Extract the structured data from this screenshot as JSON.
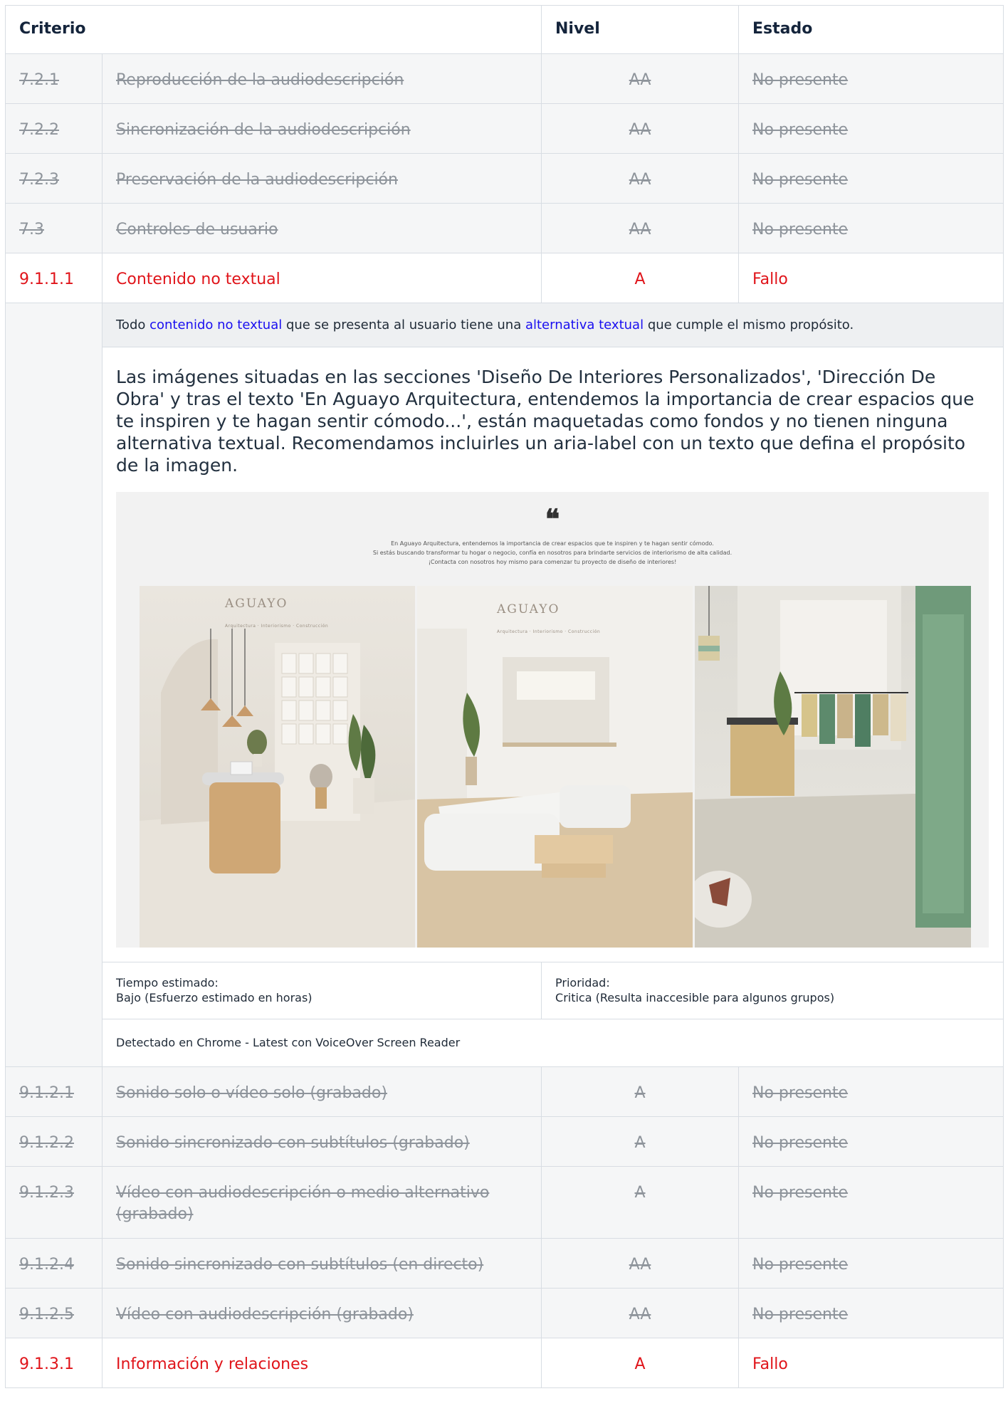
{
  "header": {
    "criterio": "Criterio",
    "nivel": "Nivel",
    "estado": "Estado"
  },
  "rows_top": [
    {
      "num": "7.2.1",
      "name": "Reproducción de la audiodescripción",
      "level": "AA",
      "status": "No presente"
    },
    {
      "num": "7.2.2",
      "name": "Sincronización de la audiodescripción",
      "level": "AA",
      "status": "No presente"
    },
    {
      "num": "7.2.3",
      "name": "Preservación de la audiodescripción",
      "level": "AA",
      "status": "No presente"
    },
    {
      "num": "7.3",
      "name": "Controles de usuario",
      "level": "AA",
      "status": "No presente"
    }
  ],
  "failure": {
    "num": "9.1.1.1",
    "name": "Contenido no textual",
    "level": "A",
    "status": "Fallo",
    "summary_start": "Todo ",
    "summary_link1": "contenido no textual",
    "summary_mid": " que se presenta al usuario tiene una ",
    "summary_link2": "alternativa textual",
    "summary_end": " que cumple el mismo propósito.",
    "description": "Las imágenes situadas en las secciones 'Diseño De Interiores Personalizados', 'Dirección De Obra' y tras el texto 'En Aguayo Arquitectura, entendemos la importancia de crear espacios que te inspiren y te hagan sentir cómodo...', están maquetadas como fondos y no tienen ninguna alternativa textual. Recomendamos incluirles un aria-label con un texto que defina el propósito de la imagen.",
    "screenshot": {
      "quote_mark": "❝",
      "line1": "En Aguayo Arquitectura, entendemos la importancia de crear espacios que te inspiren y te hagan sentir cómodo.",
      "line2": "Si estás buscando transformar tu hogar o negocio, confía en nosotros para brindarte servicios de interiorismo de alta calidad.",
      "line3": "¡Contacta con nosotros hoy mismo para comenzar tu proyecto de diseño de interiores!",
      "brand": "AGUAYO",
      "brand_sub": "Arquitectura · Interiorismo · Construcción"
    },
    "time_label": "Tiempo estimado:",
    "time_value": "Bajo (Esfuerzo estimado en horas)",
    "priority_label": "Prioridad:",
    "priority_value": "Critica (Resulta inaccesible para algunos grupos)",
    "detected": "Detectado en Chrome - Latest con VoiceOver Screen Reader"
  },
  "rows_bottom": [
    {
      "num": "9.1.2.1",
      "name": "Sonido solo o vídeo solo (grabado)",
      "level": "A",
      "status": "No presente"
    },
    {
      "num": "9.1.2.2",
      "name": "Sonido sincronizado con subtítulos (grabado)",
      "level": "A",
      "status": "No presente"
    },
    {
      "num": "9.1.2.3",
      "name": "Vídeo con audiodescripción o medio alternativo (grabado)",
      "level": "A",
      "status": "No presente"
    },
    {
      "num": "9.1.2.4",
      "name": "Sonido sincronizado con subtítulos (en directo)",
      "level": "AA",
      "status": "No presente"
    },
    {
      "num": "9.1.2.5",
      "name": "Vídeo con audiodescripción (grabado)",
      "level": "AA",
      "status": "No presente"
    }
  ],
  "last_row": {
    "num": "9.1.3.1",
    "name": "Información y relaciones",
    "level": "A",
    "status": "Fallo"
  },
  "colors": {
    "fail": "#e0141a",
    "link": "#1a0ff0",
    "muted": "#8e949b",
    "header": "#14243b"
  }
}
